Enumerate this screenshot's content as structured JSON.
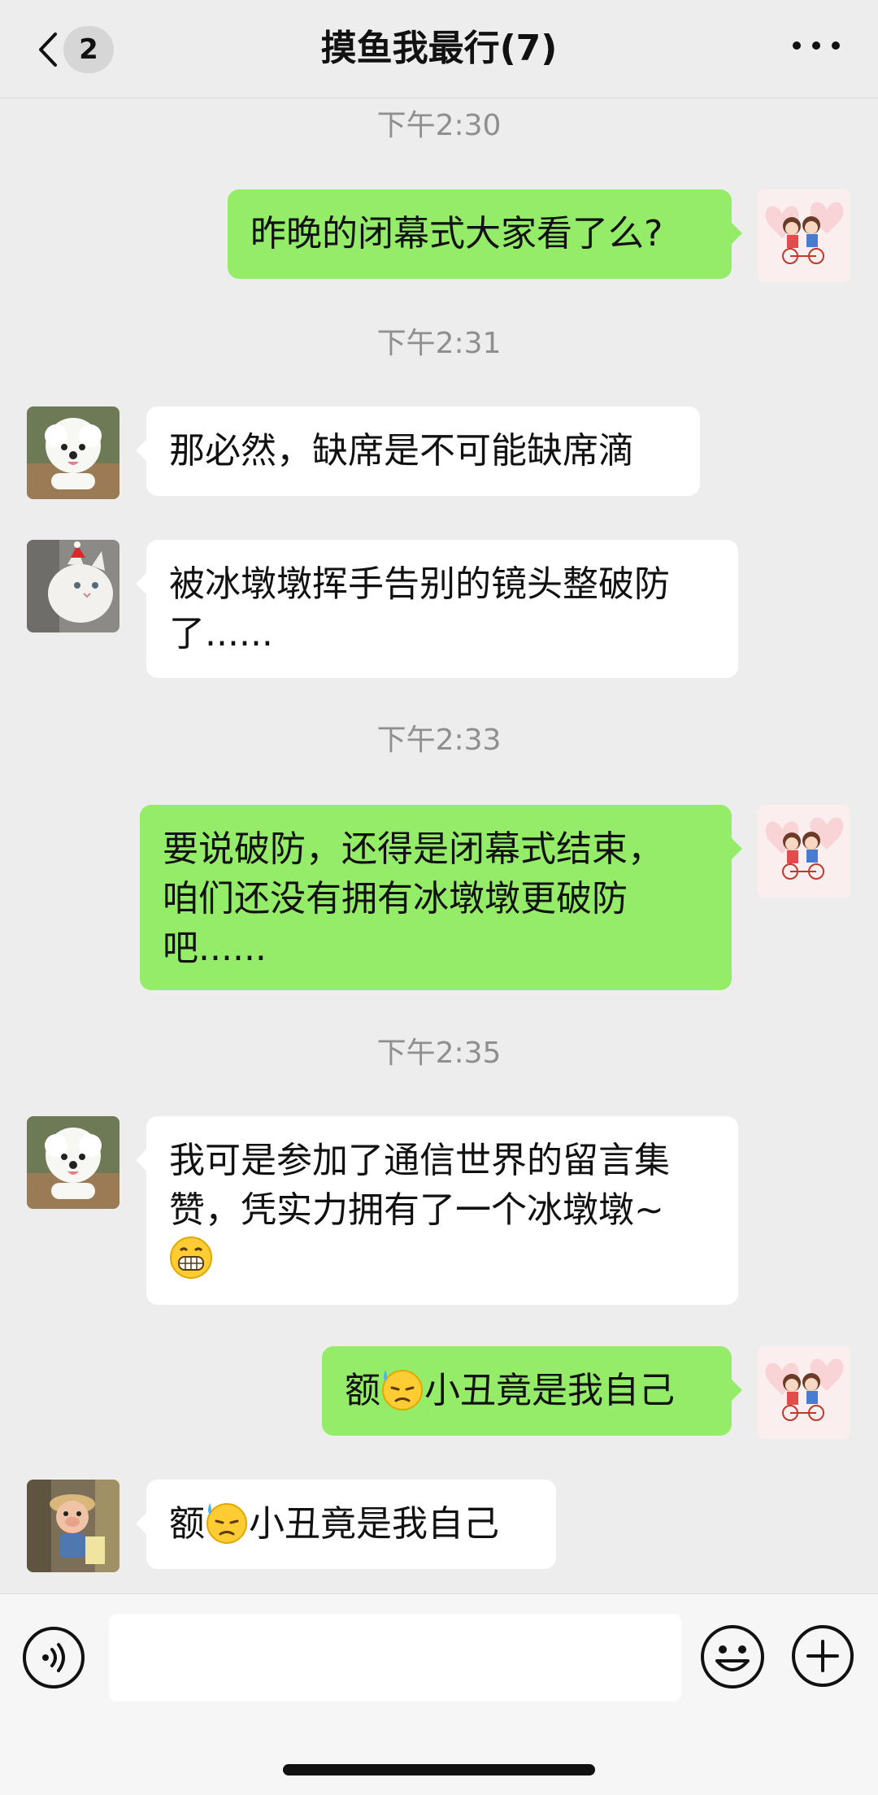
{
  "header": {
    "back_count": "2",
    "title": "摸鱼我最行(7)"
  },
  "messages": {
    "t1": "下午2:30",
    "m1": "昨晚的闭幕式大家看了么?",
    "t2": "下午2:31",
    "m2": "那必然，缺席是不可能缺席滴",
    "m3_line1": "被冰墩墩挥手告别的镜头整破防",
    "m3_line2": "了......",
    "t3": "下午2:33",
    "m4_line1": "要说破防，还得是闭幕式结束，",
    "m4_line2": "咱们还没有拥有冰墩墩更破防",
    "m4_line3": "吧......",
    "t4": "下午2:35",
    "m5_line1": "我可是参加了通信世界的留言集",
    "m5_line2": "赞，凭实力拥有了一个冰墩墩~",
    "m6_pre": "额",
    "m6_post": "小丑竟是我自己",
    "m7_pre": "额",
    "m7_post": "小丑竟是我自己"
  },
  "icons": {
    "back": "chevron-left-icon",
    "more": "more-dots-icon",
    "voice": "voice-icon",
    "emoji": "emoji-icon",
    "plus": "plus-icon",
    "sweat": "sweat-emoji",
    "grin": "grin-emoji"
  },
  "colors": {
    "outgoing_bubble": "#95ec69",
    "incoming_bubble": "#ffffff",
    "background": "#ededed",
    "timestamp": "#8f8f8f"
  }
}
